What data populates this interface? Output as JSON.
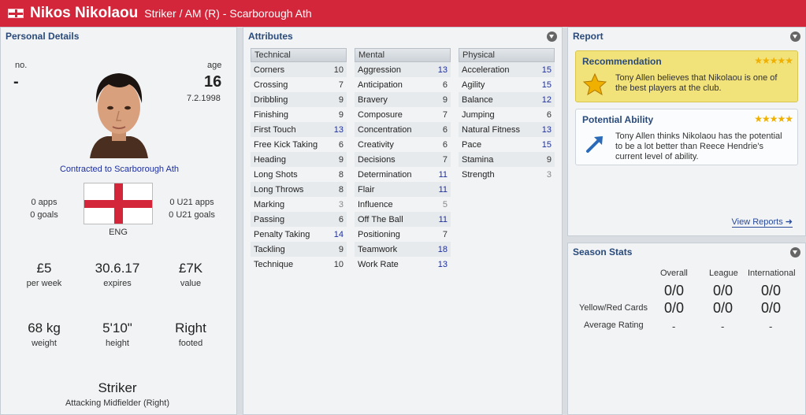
{
  "header": {
    "name": "Nikos Nikolaou",
    "subtitle": "Striker / AM (R) - Scarborough Ath"
  },
  "personal": {
    "title": "Personal Details",
    "no_label": "no.",
    "no_value": "-",
    "age_label": "age",
    "age_value": "16",
    "dob": "7.2.1998",
    "contract": "Contracted to Scarborough Ath",
    "apps": "0 apps",
    "goals": "0 goals",
    "u21_apps": "0 U21 apps",
    "u21_goals": "0 U21 goals",
    "nation": "ENG",
    "wage": "£5",
    "wage_label": "per week",
    "expires": "30.6.17",
    "expires_label": "expires",
    "value": "£7K",
    "value_label": "value",
    "weight": "68 kg",
    "weight_label": "weight",
    "height": "5'10\"",
    "height_label": "height",
    "foot": "Right",
    "foot_label": "footed",
    "position": "Striker",
    "position_sub": "Attacking Midfielder (Right)"
  },
  "attributes": {
    "title": "Attributes",
    "technical": {
      "header": "Technical",
      "items": [
        {
          "name": "Corners",
          "value": "10"
        },
        {
          "name": "Crossing",
          "value": "7"
        },
        {
          "name": "Dribbling",
          "value": "9"
        },
        {
          "name": "Finishing",
          "value": "9"
        },
        {
          "name": "First Touch",
          "value": "13"
        },
        {
          "name": "Free Kick Taking",
          "value": "6"
        },
        {
          "name": "Heading",
          "value": "9"
        },
        {
          "name": "Long Shots",
          "value": "8"
        },
        {
          "name": "Long Throws",
          "value": "8"
        },
        {
          "name": "Marking",
          "value": "3"
        },
        {
          "name": "Passing",
          "value": "6"
        },
        {
          "name": "Penalty Taking",
          "value": "14"
        },
        {
          "name": "Tackling",
          "value": "9"
        },
        {
          "name": "Technique",
          "value": "10"
        }
      ]
    },
    "mental": {
      "header": "Mental",
      "items": [
        {
          "name": "Aggression",
          "value": "13"
        },
        {
          "name": "Anticipation",
          "value": "6"
        },
        {
          "name": "Bravery",
          "value": "9"
        },
        {
          "name": "Composure",
          "value": "7"
        },
        {
          "name": "Concentration",
          "value": "6"
        },
        {
          "name": "Creativity",
          "value": "6"
        },
        {
          "name": "Decisions",
          "value": "7"
        },
        {
          "name": "Determination",
          "value": "11"
        },
        {
          "name": "Flair",
          "value": "11"
        },
        {
          "name": "Influence",
          "value": "5"
        },
        {
          "name": "Off The Ball",
          "value": "11"
        },
        {
          "name": "Positioning",
          "value": "7"
        },
        {
          "name": "Teamwork",
          "value": "18"
        },
        {
          "name": "Work Rate",
          "value": "13"
        }
      ]
    },
    "physical": {
      "header": "Physical",
      "items": [
        {
          "name": "Acceleration",
          "value": "15"
        },
        {
          "name": "Agility",
          "value": "15"
        },
        {
          "name": "Balance",
          "value": "12"
        },
        {
          "name": "Jumping",
          "value": "6"
        },
        {
          "name": "Natural Fitness",
          "value": "13"
        },
        {
          "name": "Pace",
          "value": "15"
        },
        {
          "name": "Stamina",
          "value": "9"
        },
        {
          "name": "Strength",
          "value": "3"
        }
      ]
    }
  },
  "report": {
    "title": "Report",
    "recommendation_title": "Recommendation",
    "recommendation_text": "Tony Allen believes that Nikolaou is one of the best players at the club.",
    "recommendation_stars": "★★★★★",
    "potential_title": "Potential Ability",
    "potential_text": "Tony Allen thinks Nikolaou has the potential to be a lot better than Reece Hendrie's current level of ability.",
    "potential_stars": "★★★★★",
    "view_reports": "View Reports"
  },
  "season": {
    "title": "Season Stats",
    "col_overall": "Overall",
    "col_league": "League",
    "col_international": "International",
    "row1_overall": "0/0",
    "row1_league": "0/0",
    "row1_international": "0/0",
    "cards_label": "Yellow/Red Cards",
    "cards_overall": "0/0",
    "cards_league": "0/0",
    "cards_international": "0/0",
    "rating_label": "Average Rating",
    "rating_overall": "-",
    "rating_league": "-",
    "rating_international": "-"
  },
  "colors": {
    "header_red": "#d3263a",
    "attr_high": "#1d2f9e",
    "panel_title": "#2a4a7a",
    "recommendation_bg": "#f1e27a"
  }
}
